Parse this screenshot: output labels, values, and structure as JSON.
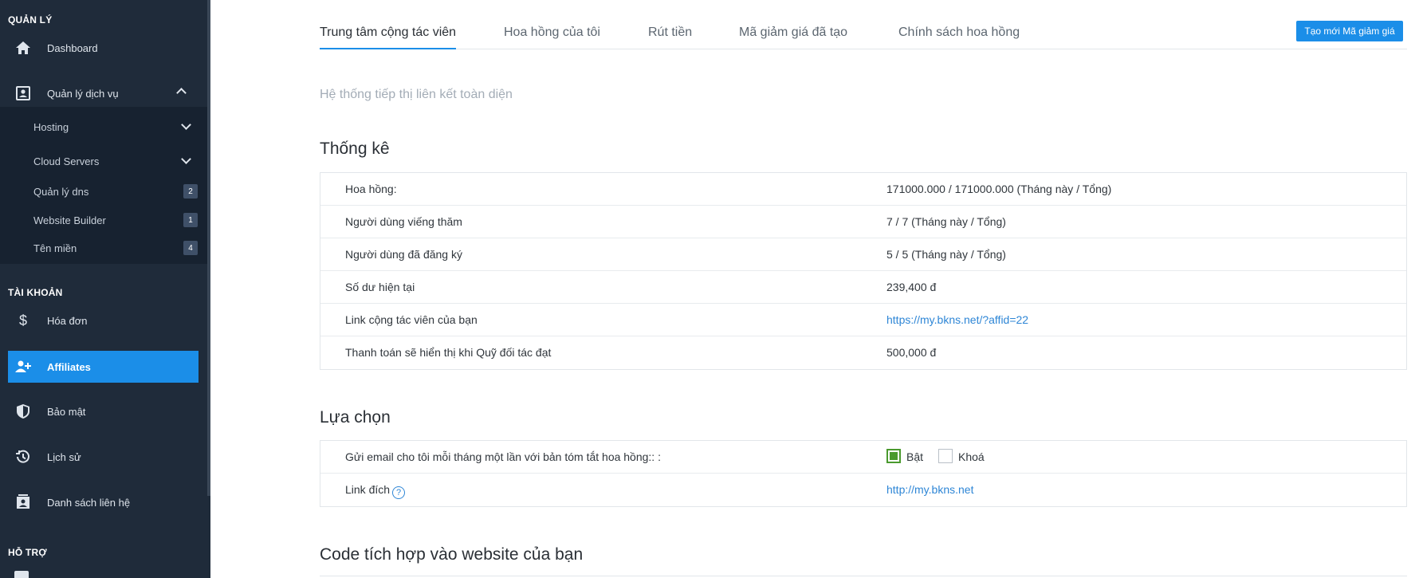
{
  "sidebar": {
    "section_manage": "QUẢN LÝ",
    "dashboard": "Dashboard",
    "services": "Quản lý dịch vụ",
    "sub_items": [
      {
        "label": "Hosting",
        "badge": ""
      },
      {
        "label": "Cloud Servers",
        "badge": ""
      },
      {
        "label": "Quản lý dns",
        "badge": "2"
      },
      {
        "label": "Website Builder",
        "badge": "1"
      },
      {
        "label": "Tên miền",
        "badge": "4"
      }
    ],
    "section_account": "TÀI KHOẢN",
    "invoices": "Hóa đơn",
    "affiliates": "Affiliates",
    "security": "Bảo mật",
    "history": "Lịch sử",
    "contacts": "Danh sách liên hệ",
    "section_support": "HỖ TRỢ"
  },
  "tabs": [
    {
      "label": "Trung tâm cộng tác viên"
    },
    {
      "label": "Hoa hồng của tôi"
    },
    {
      "label": "Rút tiền"
    },
    {
      "label": "Mã giảm giá đã tạo"
    },
    {
      "label": "Chính sách hoa hồng"
    }
  ],
  "create_coupon_button": "Tạo mới Mã giảm giá",
  "subtitle": "Hệ thống tiếp thị liên kết toàn diện",
  "stats": {
    "title": "Thống kê",
    "rows": [
      {
        "label": "Hoa hồng:",
        "value": "171000.000 / 171000.000 (Tháng này / Tổng)"
      },
      {
        "label": "Người dùng viếng thăm",
        "value": "7 / 7 (Tháng này / Tổng)"
      },
      {
        "label": "Người dùng đã đăng ký",
        "value": "5 / 5 (Tháng này / Tổng)"
      },
      {
        "label": "Số dư hiện tại",
        "value": "239,400 đ"
      },
      {
        "label": "Link cộng tác viên của bạn",
        "value": "https://my.bkns.net/?affid=22"
      },
      {
        "label": "Thanh toán sẽ hiển thị khi Quỹ đối tác đạt",
        "value": "500,000 đ"
      }
    ]
  },
  "options": {
    "title": "Lựa chọn",
    "email_label": "Gửi email cho tôi mỗi tháng một lần với bản tóm tắt hoa hồng:: :",
    "on_label": "Bật",
    "off_label": "Khoá",
    "target_label": "Link đích",
    "help_glyph": "?",
    "target_value": "http://my.bkns.net"
  },
  "embed_title": "Code tích hợp vào website của bạn",
  "colors": {
    "sidebar_bg": "#1f2b3a",
    "accent": "#1b8ee8",
    "link": "#2e86d6",
    "checkbox_on": "#4a9a2e"
  }
}
